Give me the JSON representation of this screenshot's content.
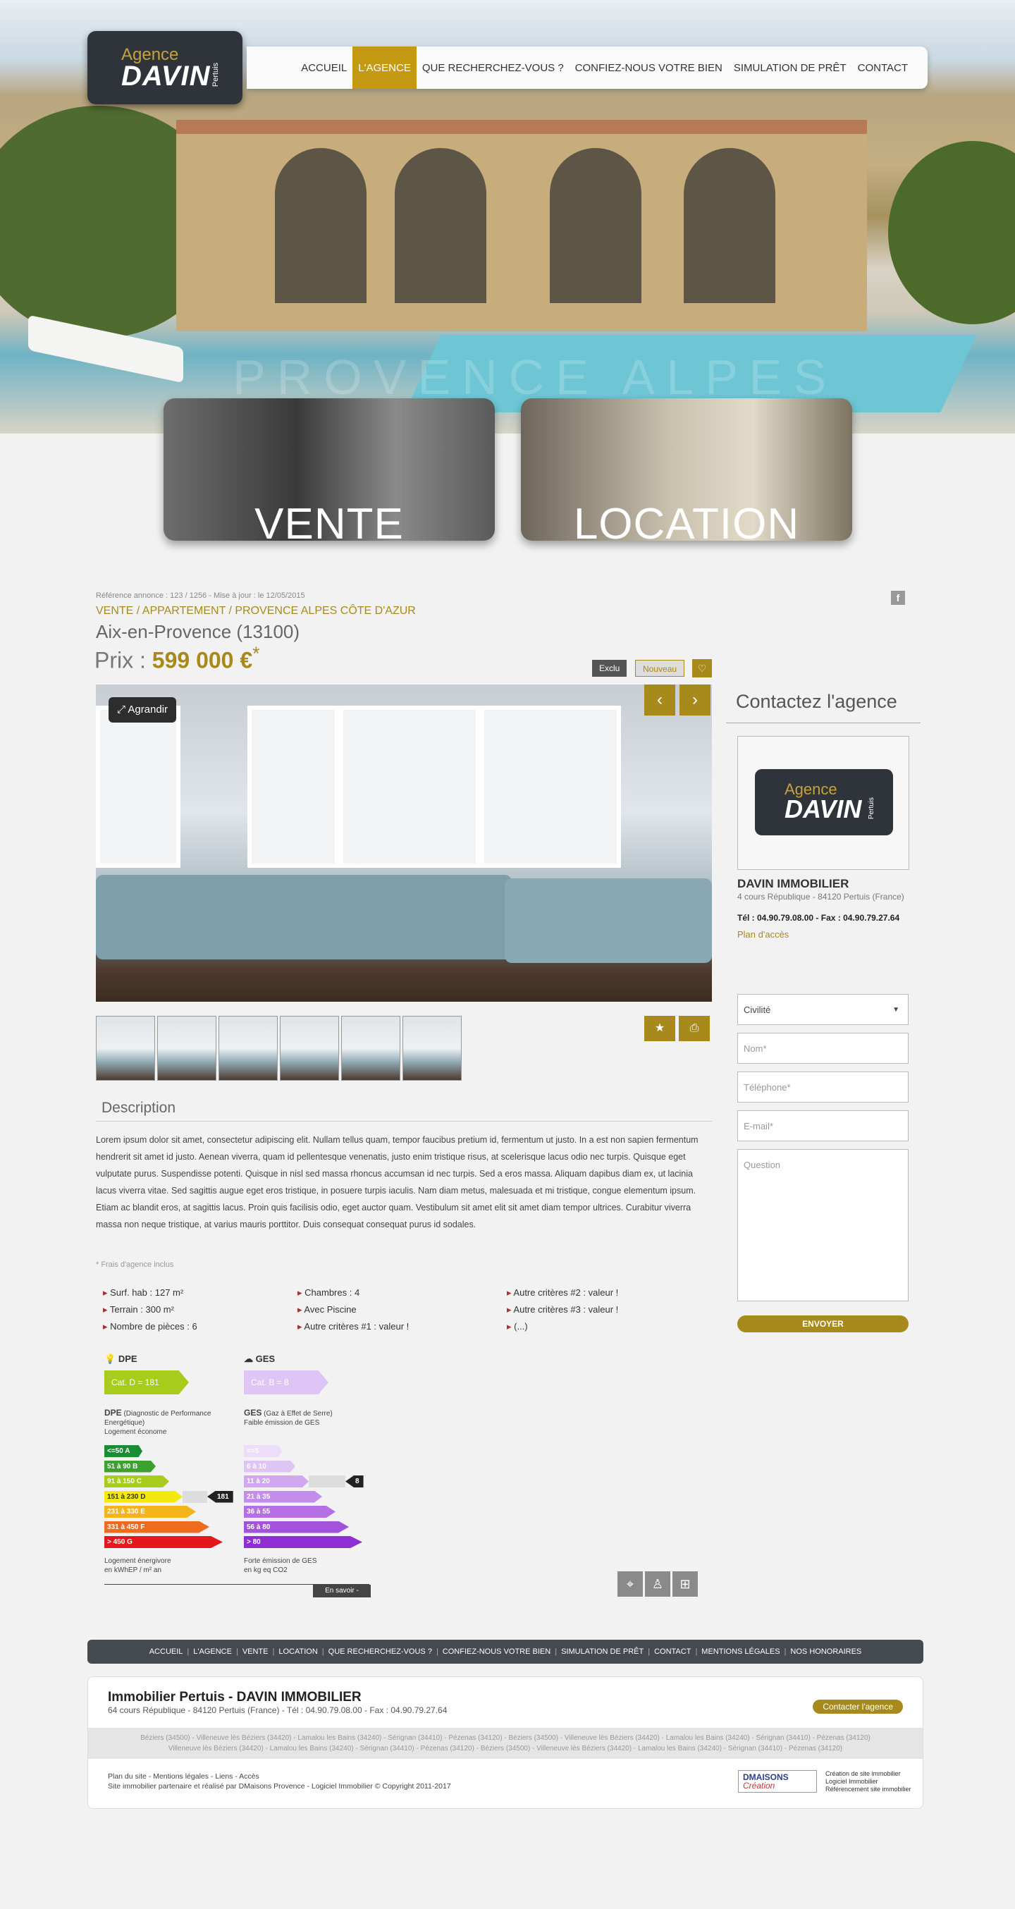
{
  "header": {
    "logo": {
      "line1": "Agence",
      "line2": "DAVIN",
      "line3": "Pertuis"
    },
    "nav": [
      "ACCUEIL",
      "L'AGENCE",
      "QUE RECHERCHEZ-VOUS ?",
      "CONFIEZ-NOUS VOTRE BIEN",
      "SIMULATION DE PRÊT",
      "CONTACT"
    ],
    "active_nav": "L'AGENCE",
    "hero_watermark": "PROVENCE ALPES CÔTE"
  },
  "categories": {
    "vente": "VENTE",
    "location": "LOCATION"
  },
  "listing": {
    "reference": "Référence annonce : 123 / 1256 - Mise à jour : le 12/05/2015",
    "facebook": "f",
    "breadcrumb": "VENTE / APPARTEMENT / PROVENCE ALPES CÔTE D'AZUR",
    "city": "Aix-en-Provence (13100)",
    "price_label": "Prix : ",
    "price_value": "599 000 €",
    "price_star": "*",
    "tag_exclu": "Exclu",
    "tag_nouveau": "Nouveau",
    "fav_icon": "♡",
    "agrandir": "Agrandir",
    "prev": "‹",
    "next": "›",
    "star_btn": "★",
    "print_btn": "⎙"
  },
  "description": {
    "title": "Description",
    "text": "Lorem ipsum dolor sit amet, consectetur adipiscing elit. Nullam tellus quam, tempor faucibus pretium id, fermentum ut justo. In a est non sapien fermentum hendrerit sit amet id justo. Aenean viverra, quam id pellentesque venenatis, justo enim tristique risus, at scelerisque lacus odio nec turpis. Quisque eget vulputate purus. Suspendisse potenti. Quisque in nisl sed massa rhoncus accumsan id nec turpis. Sed a eros massa. Aliquam dapibus diam ex, ut lacinia lacus viverra vitae. Sed sagittis augue eget eros tristique, in posuere turpis iaculis. Nam diam metus, malesuada et mi tristique, congue elementum ipsum. Etiam ac blandit eros, at sagittis lacus. Proin quis facilisis odio, eget auctor quam. Vestibulum sit amet elit sit amet diam tempor ultrices. Curabitur viverra massa non neque tristique, at varius mauris porttitor. Duis consequat consequat purus id sodales.",
    "frais": "* Frais d'agence inclus"
  },
  "criteria": [
    [
      "Surf. hab : 127 m²",
      "Terrain : 300 m²",
      "Nombre de pièces : 6"
    ],
    [
      "Chambres : 4",
      "Avec Piscine",
      "Autre critères #1 : valeur !"
    ],
    [
      "Autre critères #2 : valeur !",
      "Autre critères #3 : valeur !",
      "(...)"
    ]
  ],
  "energy": {
    "dpe_title": "DPE",
    "dpe_tag": "Cat. D = 181",
    "ges_title": "GES",
    "ges_tag": "Cat. B = 8",
    "dpe_label": "DPE",
    "dpe_sub": "(Diagnostic de Performance Energétique)",
    "dpe_top": "Logement économe",
    "dpe_bars": [
      "<=50",
      "51 à 90",
      "91 à 150",
      "151 à 230",
      "231 à 330",
      "331 à 450",
      "> 450"
    ],
    "dpe_letters": [
      "A",
      "B",
      "C",
      "D",
      "E",
      "F",
      "G"
    ],
    "dpe_colors": [
      "#1a8d33",
      "#3ca12e",
      "#a8cc1b",
      "#f5e80f",
      "#f6b41b",
      "#ef6b1e",
      "#e3181d"
    ],
    "dpe_value": "181",
    "dpe_value_index": 3,
    "dpe_bottom1": "Logement énergivore",
    "dpe_bottom2": "en kWhEP / m² an",
    "ges_label": "GES",
    "ges_sub": "(Gaz à Effet de Serre)",
    "ges_top": "Faible émission de GES",
    "ges_bars": [
      "<=5",
      "6 à 10",
      "11 à 20",
      "21 à 35",
      "36 à 55",
      "56 à 80",
      "> 80"
    ],
    "ges_colors": [
      "#eedcfb",
      "#dfc4f6",
      "#d1a8f0",
      "#c28deb",
      "#b36fe3",
      "#a352dc",
      "#8f2fd3"
    ],
    "ges_value": "8",
    "ges_value_index": 2,
    "ges_bottom1": "Forte émission de GES",
    "ges_bottom2": "en kg eq CO2",
    "en_savoir": "En savoir -"
  },
  "sidebar": {
    "title": "Contactez l'agence",
    "agency": "DAVIN IMMOBILIER",
    "address": "4 cours République - 84120 Pertuis (France)",
    "tel": "Tél : 04.90.79.08.00 - Fax : 04.90.79.27.64",
    "plan": "Plan d'accès",
    "civilite": "Civilité",
    "nom": "Nom*",
    "tel_ph": "Téléphone*",
    "email": "E-mail*",
    "question": "Question",
    "send": "ENVOYER"
  },
  "footer": {
    "nav": [
      "ACCUEIL",
      "L'AGENCE",
      "VENTE",
      "LOCATION",
      "QUE RECHERCHEZ-VOUS ?",
      "CONFIEZ-NOUS VOTRE BIEN",
      "SIMULATION DE PRÊT",
      "CONTACT",
      "MENTIONS LÉGALES",
      "NOS HONORAIRES"
    ],
    "title": "Immobilier Pertuis - DAVIN IMMOBILIER",
    "address": "64 cours République - 84120 Pertuis (France) - Tél : 04.90.79.08.00 - Fax : 04.90.79.27.64",
    "contact_btn": "Contacter l'agence",
    "towns1": "Béziers (34500) - Villeneuve lès Béziers (34420) - Lamalou les Bains (34240) - Sérignan (34410) - Pézenas (34120) - Béziers (34500) - Villeneuve lès Béziers (34420) - Lamalou les Bains (34240) - Sérignan (34410) - Pézenas (34120)",
    "towns2": "Villeneuve lès Béziers (34420) - Lamalou les Bains (34240) - Sérignan (34410) - Pézenas (34120) - Béziers (34500) - Villeneuve lès Béziers (34420) - Lamalou les Bains (34240) - Sérignan (34410) - Pézenas (34120)",
    "links1": "Plan du site - Mentions légales - Liens - Accès",
    "links2": "Site immobilier partenaire et réalisé par DMaisons Provence - Logiciel Immobilier © Copyright 2011-2017",
    "dm_brand": "DMAISONS",
    "dm_sub": "Création",
    "dm_r1": "Création de site immobilier",
    "dm_r2": "Logiciel Immobilier",
    "dm_r3": "Référencement site immobilier"
  }
}
